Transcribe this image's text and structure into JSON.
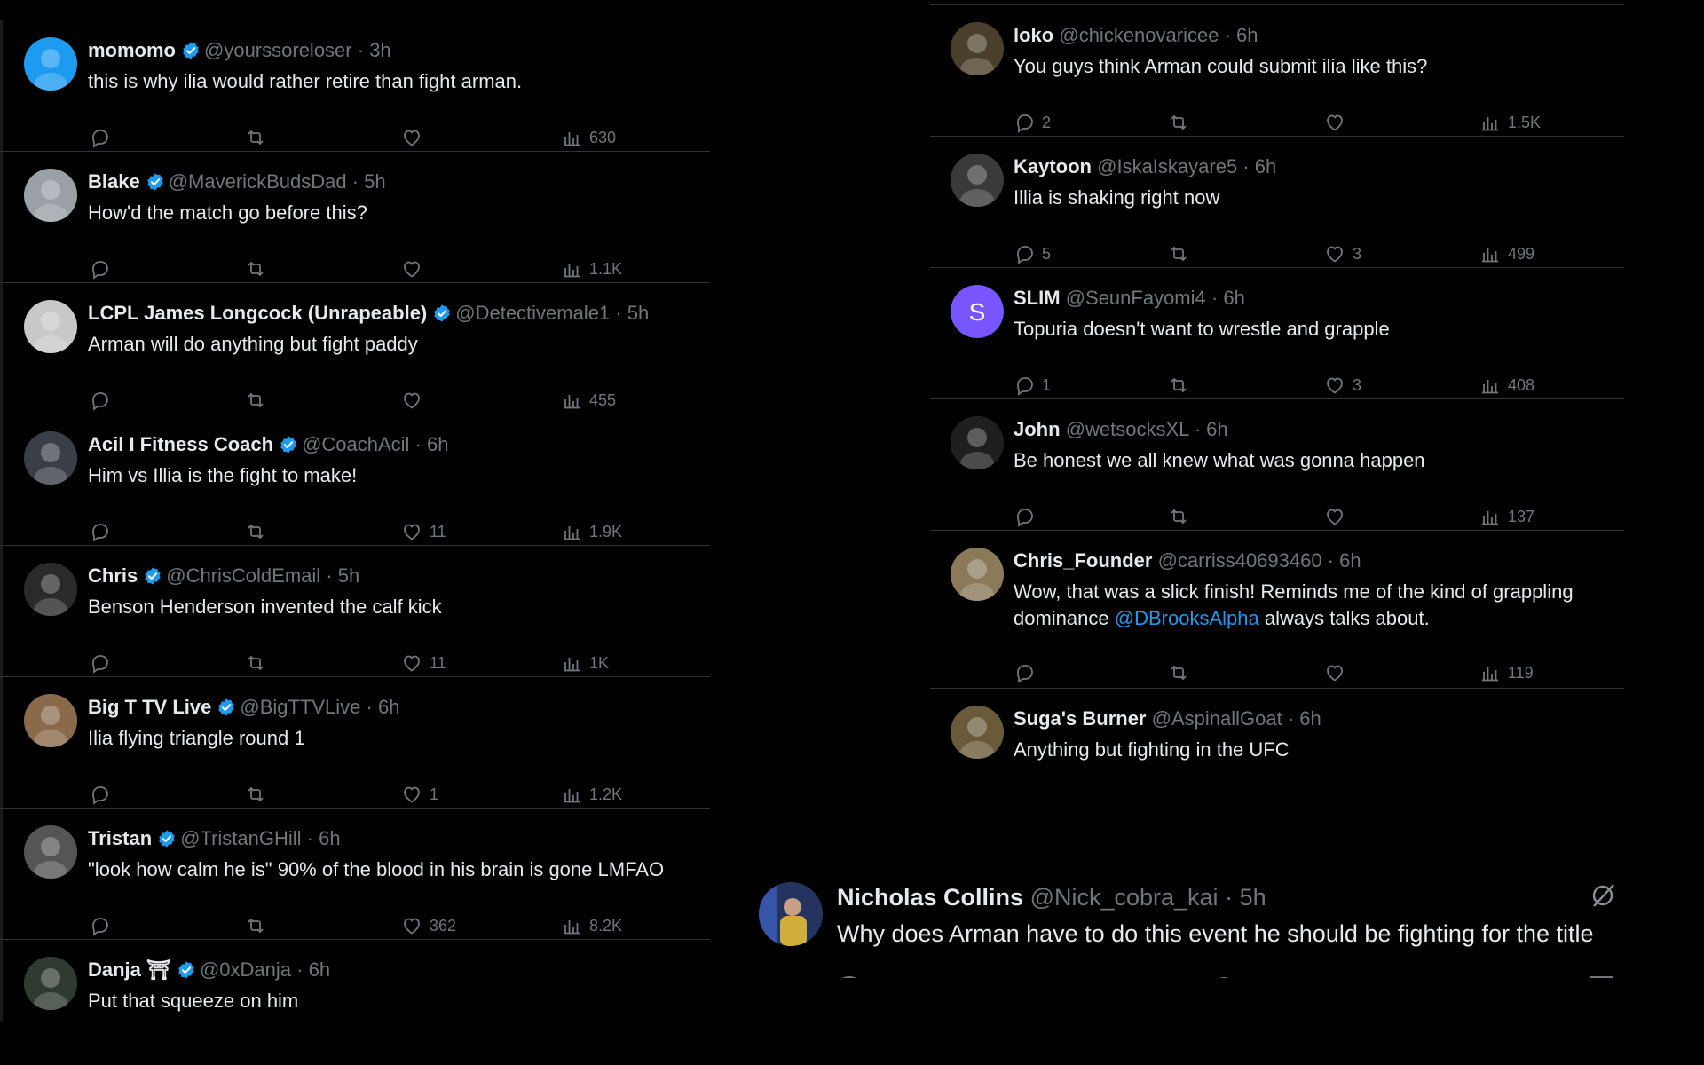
{
  "left_replies": [
    {
      "name": "momomo",
      "handle": "@yourssoreloser",
      "time": "3h",
      "text": "this is why ilia would rather retire than fight arman.",
      "reply": "",
      "repost": "",
      "like": "",
      "views": "630",
      "avatar_color": "#1d9bf0"
    },
    {
      "name": "Blake",
      "handle": "@MaverickBudsDad",
      "time": "5h",
      "text": "How'd the match go before this?",
      "reply": "",
      "repost": "",
      "like": "",
      "views": "1.1K",
      "avatar_color": "#9aa0a6"
    },
    {
      "name": "LCPL James Longcock (Unrapeable)",
      "handle": "@Detectivemale1",
      "time": "5h",
      "text": "Arman will do anything but fight paddy",
      "reply": "",
      "repost": "",
      "like": "",
      "views": "455",
      "avatar_color": "#c8c8c8"
    },
    {
      "name": "Acil I Fitness Coach",
      "handle": "@CoachAcil",
      "time": "6h",
      "text": "Him vs Illia is the fight to make!",
      "reply": "",
      "repost": "",
      "like": "11",
      "views": "1.9K",
      "avatar_color": "#3a3f47"
    },
    {
      "name": "Chris",
      "handle": "@ChrisColdEmail",
      "time": "5h",
      "text": "Benson Henderson invented the calf kick",
      "reply": "",
      "repost": "",
      "like": "11",
      "views": "1K",
      "avatar_color": "#2a2a2a"
    },
    {
      "name": "Big T TV Live",
      "handle": "@BigTTVLive",
      "time": "6h",
      "text": "Ilia flying triangle round 1",
      "reply": "",
      "repost": "",
      "like": "1",
      "views": "1.2K",
      "avatar_color": "#8a6a4a"
    },
    {
      "name": "Tristan",
      "handle": "@TristanGHill",
      "time": "6h",
      "text": "\"look how calm he is\" 90% of the blood in his brain is gone LMFAO",
      "reply": "",
      "repost": "",
      "like": "362",
      "views": "8.2K",
      "avatar_color": "#555555"
    },
    {
      "name": "Danja ⛩",
      "handle": "@0xDanja",
      "time": "6h",
      "text": "Put that squeeze on him",
      "reply": "",
      "repost": "",
      "like": "",
      "views": "",
      "avatar_color": "#2f3a30"
    }
  ],
  "right_replies": [
    {
      "name": "loko",
      "handle": "@chickenovaricee",
      "time": "6h",
      "text": "You guys think Arman  could submit ilia like this?",
      "reply": "2",
      "repost": "",
      "like": "",
      "views": "1.5K",
      "avatar_color": "#4a3f2a"
    },
    {
      "name": "Kaytoon",
      "handle": "@IskaIskayare5",
      "time": "6h",
      "text": "Illia is shaking right now",
      "reply": "5",
      "repost": "",
      "like": "3",
      "views": "499",
      "avatar_color": "#3a3a3a"
    },
    {
      "name": "SLIM",
      "handle": "@SeunFayomi4",
      "time": "6h",
      "text": "Topuria doesn't want to wrestle and grapple",
      "reply": "1",
      "repost": "",
      "like": "3",
      "views": "408",
      "avatar_color": "#7856ff",
      "avatar_letter": "S"
    },
    {
      "name": "John",
      "handle": "@wetsocksXL",
      "time": "6h",
      "text": "Be honest we all knew what was gonna happen",
      "reply": "",
      "repost": "",
      "like": "",
      "views": "137",
      "avatar_color": "#1f1f1f"
    },
    {
      "name": "Chris_Founder",
      "handle": "@carriss40693460",
      "time": "6h",
      "text_before": "Wow, that was a slick finish! Reminds me of the kind of grappling dominance ",
      "mention": "@DBrooksAlpha",
      "text_after": " always talks about.",
      "reply": "",
      "repost": "",
      "like": "",
      "views": "119",
      "avatar_color": "#8a7a5a"
    },
    {
      "name": "Suga's Burner",
      "handle": "@AspinallGoat",
      "time": "6h",
      "text": "Anything but fighting in the UFC",
      "avatar_color": "#6a5a3a"
    }
  ],
  "featured_reply": {
    "name": "Nicholas Collins",
    "handle": "@Nick_cobra_kai",
    "time": "5h",
    "text": "Why does Arman have to do this event he should be fighting for the title",
    "avatar_color": "#2a3a6a"
  },
  "colors": {
    "background": "#000000",
    "text": "#e7e9ea",
    "muted": "#71767b",
    "verified": "#1d9bf0",
    "divider": "#2f3336"
  }
}
